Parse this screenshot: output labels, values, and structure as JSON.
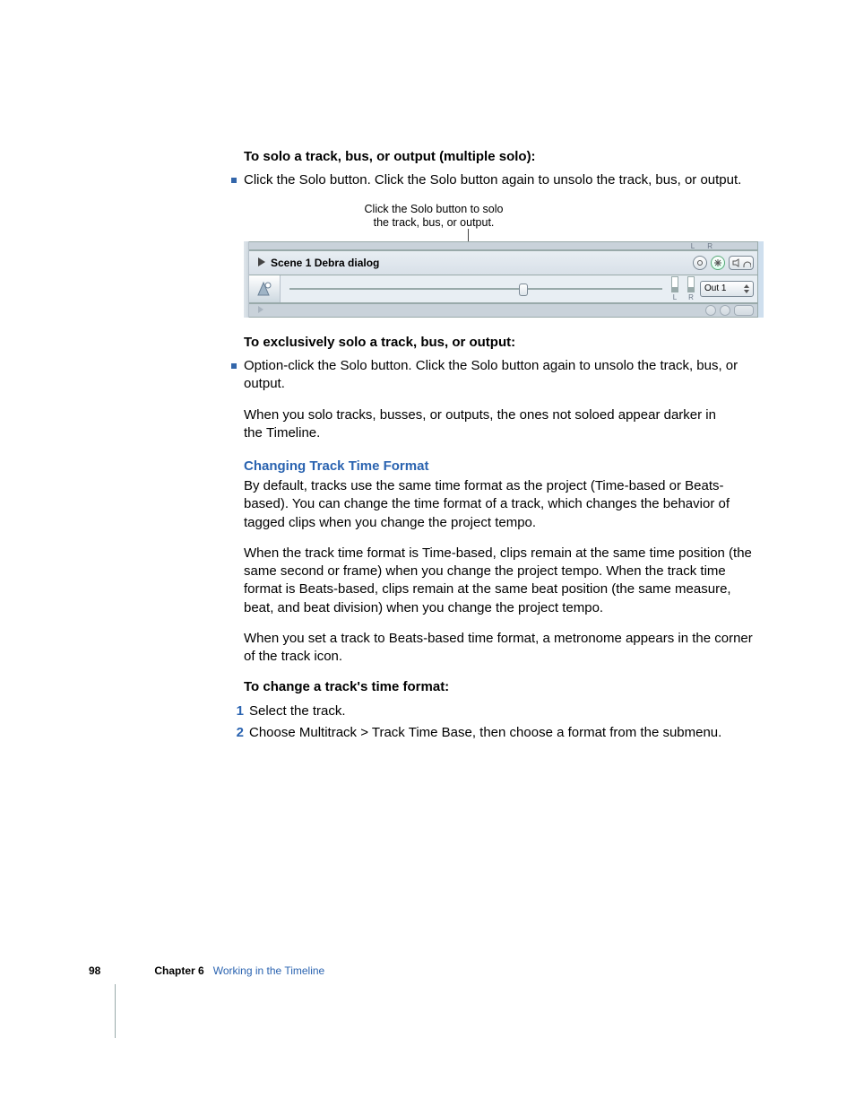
{
  "section1": {
    "heading": "To solo a track, bus, or output (multiple solo):",
    "bullet": "Click the Solo button. Click the Solo button again to unsolo the track, bus, or output."
  },
  "figure": {
    "callout_l1": "Click the Solo button to solo",
    "callout_l2": "the track, bus, or output.",
    "track_name": "Scene 1 Debra dialog",
    "meter_l": "L",
    "meter_r": "R",
    "out_label": "Out 1"
  },
  "section2": {
    "heading": "To exclusively solo a track, bus, or output:",
    "bullet": "Option-click the Solo button. Click the Solo button again to unsolo the track, bus, or output.",
    "para": "When you solo tracks, busses, or outputs, the ones not soloed appear darker in the Timeline."
  },
  "changing": {
    "heading": "Changing Track Time Format",
    "p1": "By default, tracks use the same time format as the project (Time-based or Beats-based). You can change the time format of a track, which changes the behavior of tagged clips when you change the project tempo.",
    "p2": "When the track time format is Time-based, clips remain at the same time position (the same second or frame) when you change the project tempo. When the track time format is Beats-based, clips remain at the same beat position (the same measure, beat, and beat division) when you change the project tempo.",
    "p3": "When you set a track to Beats-based time format, a metronome appears in the corner of the track icon."
  },
  "steps": {
    "heading": "To change a track's time format:",
    "n1": "1",
    "s1": "Select the track.",
    "n2": "2",
    "s2": "Choose Multitrack > Track Time Base, then choose a format from the submenu."
  },
  "footer": {
    "page": "98",
    "chapter": "Chapter 6",
    "title": "Working in the Timeline"
  }
}
